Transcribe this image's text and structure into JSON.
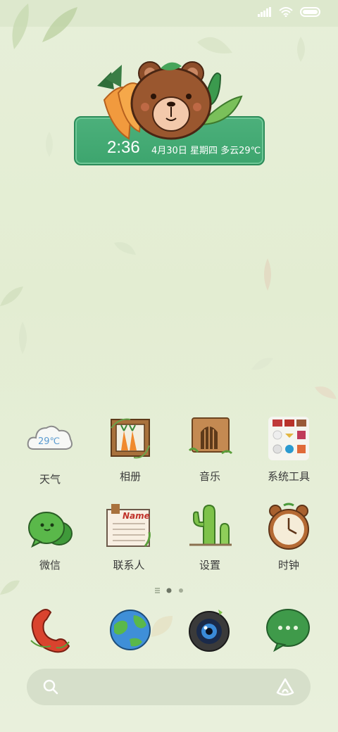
{
  "status_bar": {
    "signal_icon": "signal-icon",
    "wifi_icon": "wifi-icon",
    "battery_icon": "battery-icon"
  },
  "clock_widget": {
    "time": "2:36",
    "date": "4月30日 星期四 多云29℃"
  },
  "apps": [
    {
      "label": "天气",
      "icon": "weather-cloud-icon",
      "temp": "29℃"
    },
    {
      "label": "相册",
      "icon": "gallery-frame-icon"
    },
    {
      "label": "音乐",
      "icon": "music-box-icon"
    },
    {
      "label": "系统工具",
      "icon": "system-tools-folder-icon"
    },
    {
      "label": "微信",
      "icon": "wechat-icon"
    },
    {
      "label": "联系人",
      "icon": "contacts-notepad-icon",
      "note": "Name"
    },
    {
      "label": "设置",
      "icon": "cactus-settings-icon"
    },
    {
      "label": "时钟",
      "icon": "alarm-clock-icon"
    }
  ],
  "dock": [
    {
      "icon": "phone-icon"
    },
    {
      "icon": "browser-globe-icon"
    },
    {
      "icon": "camera-icon"
    },
    {
      "icon": "messages-icon"
    }
  ],
  "page_indicator": {
    "pages": 3,
    "current": 2
  },
  "search": {
    "search_icon": "search-icon",
    "assistant_icon": "assistant-icon"
  },
  "colors": {
    "widget_green": "#3da56e",
    "background": "#e5eed6"
  }
}
